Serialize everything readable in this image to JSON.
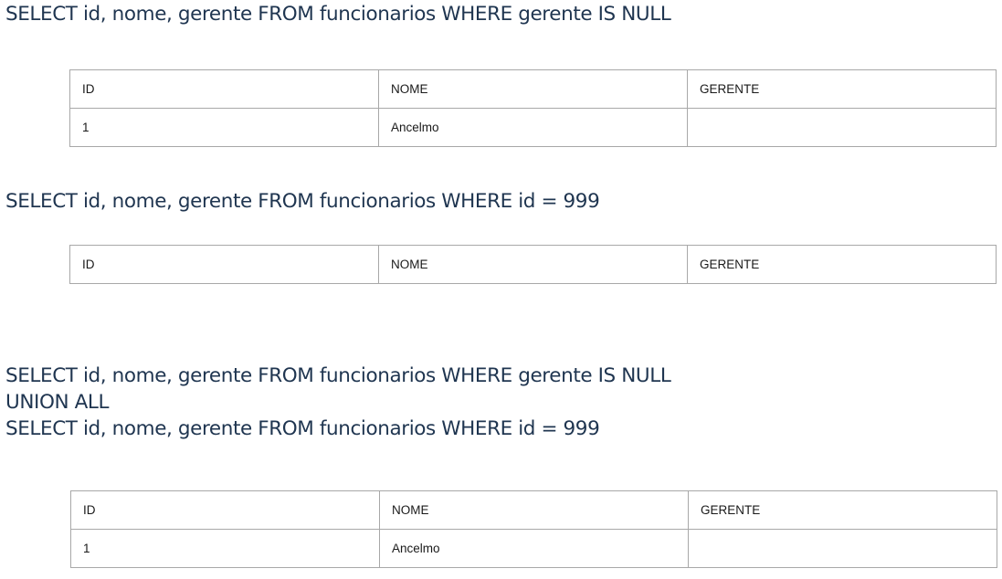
{
  "queries": [
    {
      "lines": [
        "SELECT id, nome, gerente FROM funcionarios WHERE gerente IS NULL"
      ],
      "result": {
        "headers": [
          "ID",
          "NOME",
          "GERENTE"
        ],
        "rows": [
          [
            "1",
            "Ancelmo",
            ""
          ]
        ]
      }
    },
    {
      "lines": [
        "SELECT id, nome, gerente FROM funcionarios WHERE id = 999"
      ],
      "result": {
        "headers": [
          "ID",
          "NOME",
          "GERENTE"
        ],
        "rows": []
      }
    },
    {
      "lines": [
        "SELECT id, nome, gerente FROM funcionarios WHERE gerente IS NULL",
        "UNION ALL",
        "SELECT id, nome, gerente FROM funcionarios WHERE id = 999"
      ],
      "result": {
        "headers": [
          "ID",
          "NOME",
          "GERENTE"
        ],
        "rows": [
          [
            "1",
            "Ancelmo",
            ""
          ]
        ]
      }
    }
  ],
  "colors": {
    "query_text": "#1f3550",
    "table_border": "#a8a8a8"
  }
}
